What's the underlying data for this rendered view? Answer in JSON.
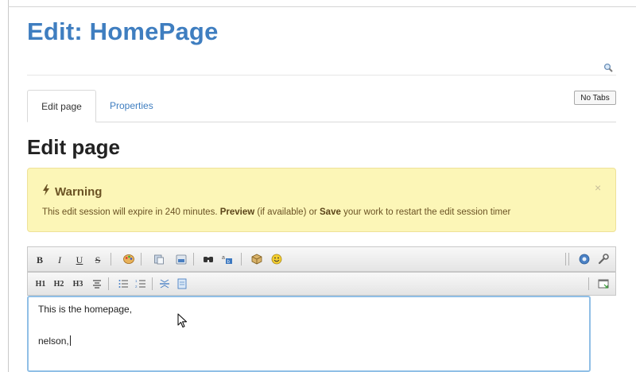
{
  "page": {
    "title": "Edit: HomePage",
    "section_title": "Edit page"
  },
  "tabs": [
    {
      "label": "Edit page",
      "active": true
    },
    {
      "label": "Properties",
      "active": false
    }
  ],
  "no_tabs_label": "No Tabs",
  "alert": {
    "title": "Warning",
    "close_glyph": "×",
    "msg_part1": "This edit session will expire in 240 minutes. ",
    "msg_preview": "Preview",
    "msg_part2": " (if available) or ",
    "msg_save": "Save",
    "msg_part3": " your work to restart the edit session timer"
  },
  "toolbar1": {
    "bold": "B",
    "italic": "I",
    "underline": "U",
    "strike": "S"
  },
  "toolbar2": {
    "h1": "H1",
    "h2": "H2",
    "h3": "H3"
  },
  "editor": {
    "line1": "This is the homepage,",
    "line2": "nelson,"
  },
  "colors": {
    "accent": "#3f7ec0",
    "alert_bg": "#fcf6b7",
    "alert_text": "#6b5324",
    "focus": "#90bfe6"
  }
}
